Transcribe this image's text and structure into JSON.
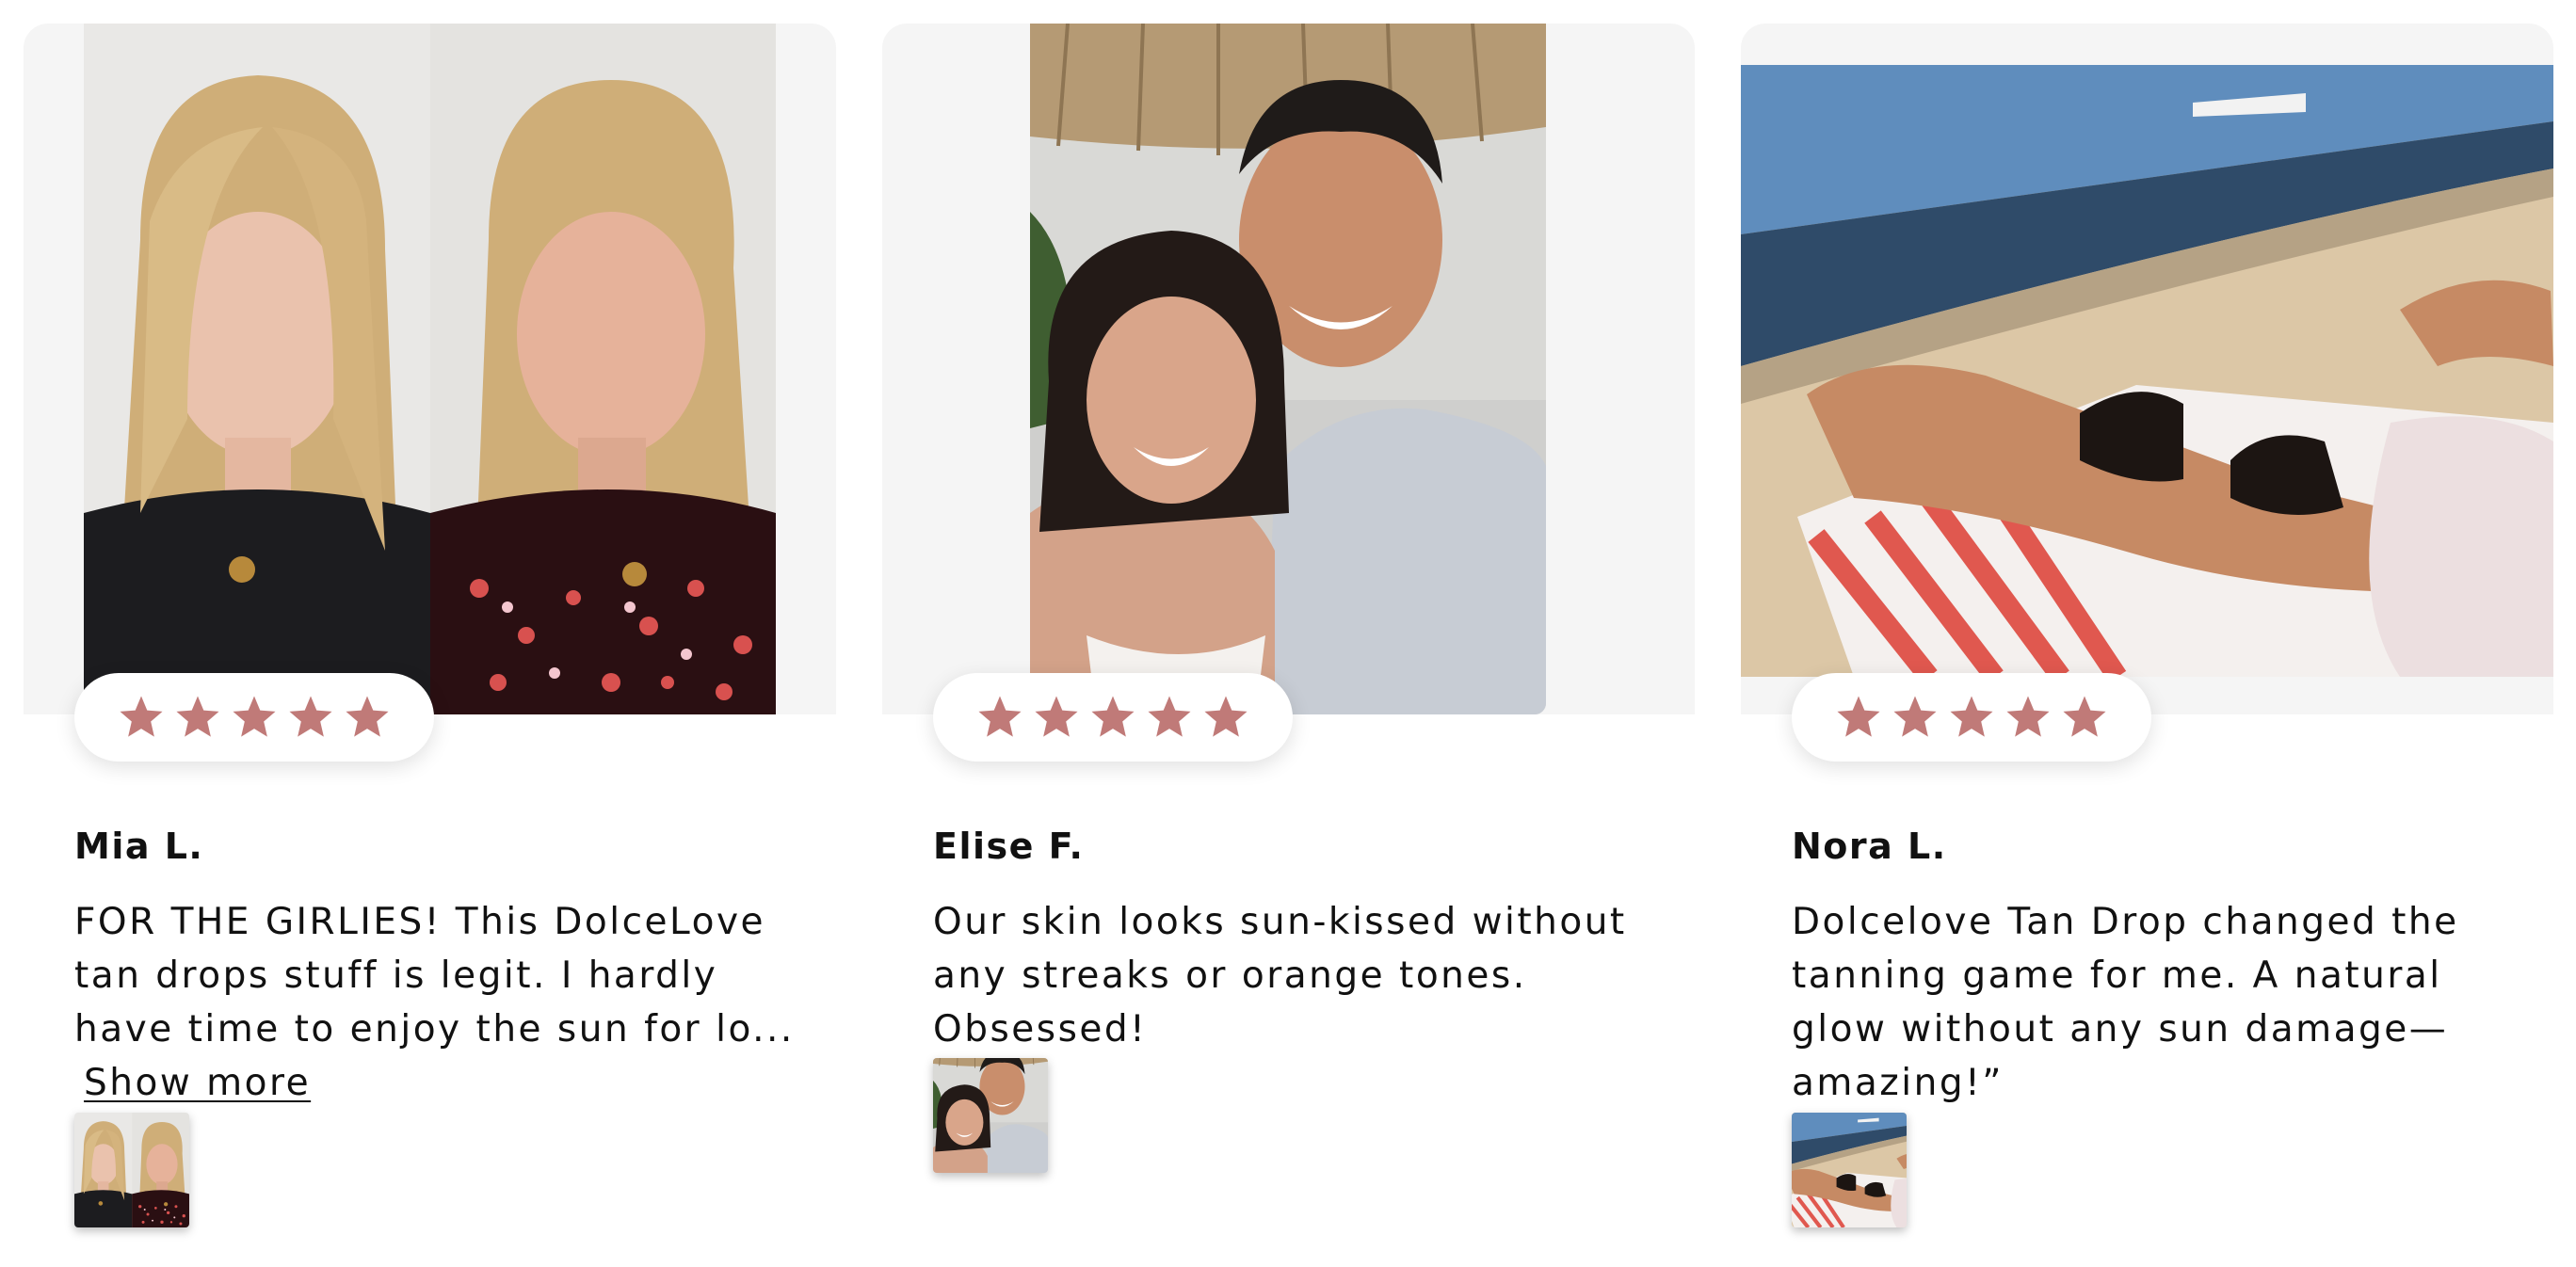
{
  "colors": {
    "star": "#c07a78",
    "media_background": "#f5f5f5",
    "text": "#111111"
  },
  "reviews": [
    {
      "name": "Mia L.",
      "rating": 5,
      "rating_max": 5,
      "text": "FOR THE GIRLIES! This DolceLove tan drops stuff is legit. I hardly have time to enjoy the sun for lo...",
      "show_more_label": "Show more",
      "photo_icon": "before-after-selfie-photo",
      "thumbnail_icon": "before-after-selfie-thumbnail"
    },
    {
      "name": "Elise F.",
      "rating": 5,
      "rating_max": 5,
      "text": "Our skin looks sun-kissed without any streaks or orange tones. Obsessed!",
      "photo_icon": "couple-selfie-photo",
      "thumbnail_icon": "couple-selfie-thumbnail"
    },
    {
      "name": "Nora L.",
      "rating": 5,
      "rating_max": 5,
      "text": "Dolcelove Tan Drop changed the tanning game for me. A natural glow without any sun damage—amazing!”",
      "photo_icon": "beach-sunbathing-photo",
      "thumbnail_icon": "beach-sunbathing-thumbnail"
    }
  ]
}
